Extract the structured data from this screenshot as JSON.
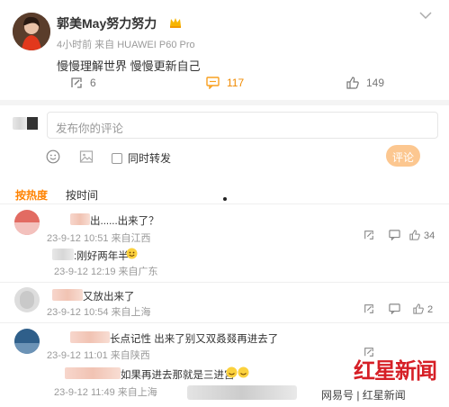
{
  "post": {
    "author": "郭美May努力努力",
    "time_line": "4小时前 来自 HUAWEI P60 Pro",
    "text": "慢慢理解世界 慢慢更新自己",
    "repost_count": "6",
    "comment_count": "117",
    "like_count": "149"
  },
  "composer": {
    "placeholder": "发布你的评论",
    "also_repost_label": "同时转发",
    "submit_label": "评论"
  },
  "sort": {
    "hot_label": "按热度",
    "time_label": "按时间"
  },
  "comments": [
    {
      "text": "出......出来了？",
      "time": "23-9-12 10:51 来自江西",
      "likes": "34"
    },
    {
      "text": ":刚好两年半",
      "time": "23-9-12 12:19 来自广东",
      "likes": ""
    },
    {
      "text": "又放出来了",
      "time": "23-9-12 10:54 来自上海",
      "likes": "2"
    },
    {
      "text": "长点记性 出来了别又双叒叕再进去了",
      "time": "23-9-12 11:01 来自陕西",
      "likes": ""
    },
    {
      "text": "如果再进去那就是三进宫",
      "time": "23-9-12 11:49 来自上海",
      "likes": ""
    }
  ],
  "watermark": {
    "brand": "红星新闻",
    "credit": "网易号 | 红星新闻"
  },
  "colors": {
    "accent": "#ff8200",
    "submit_bg": "#fcc790",
    "comment_icon": "#f9a020",
    "brand_red": "#d61f26"
  }
}
